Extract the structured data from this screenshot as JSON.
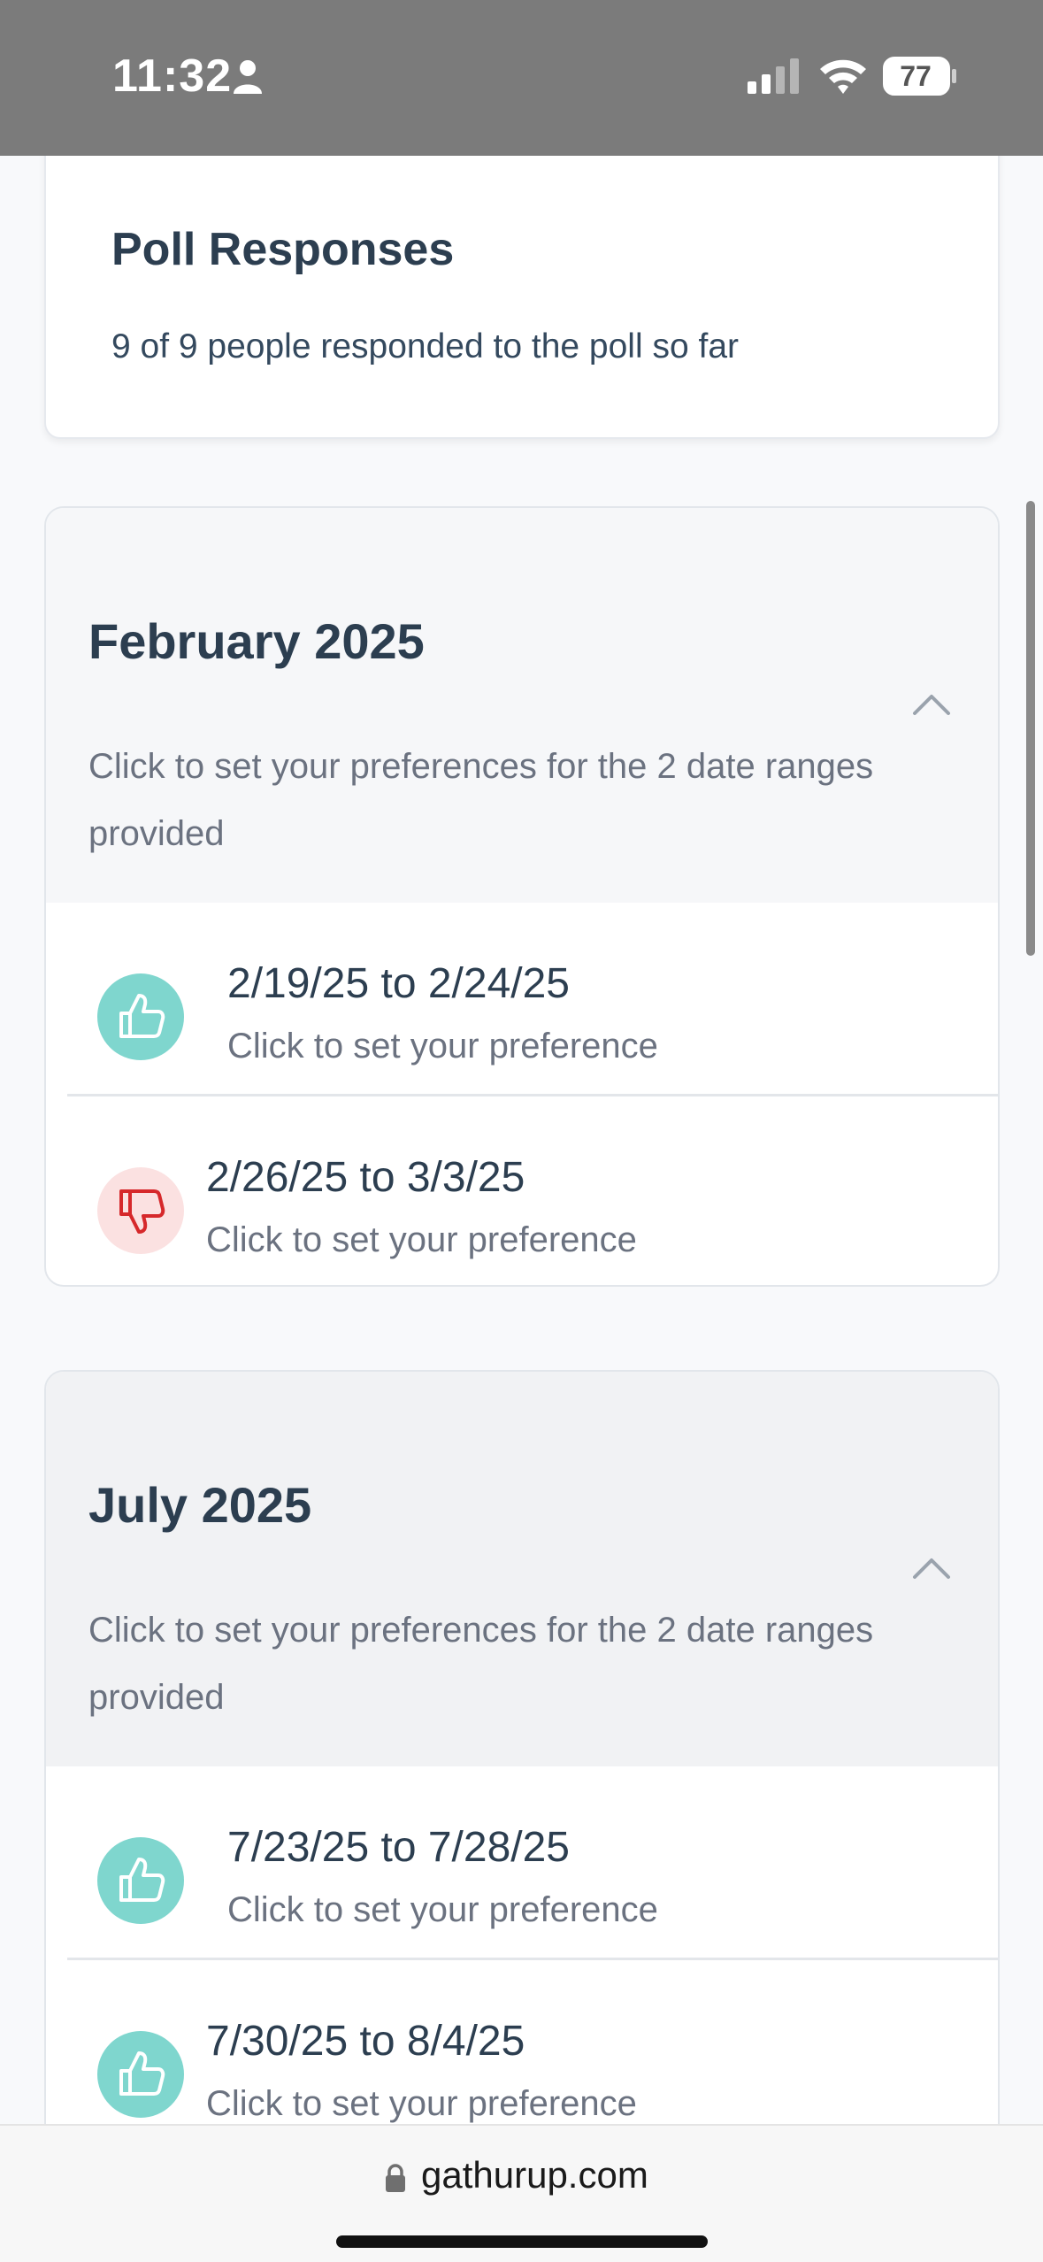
{
  "status_bar": {
    "time": "11:32",
    "battery": "77",
    "icons": [
      "person-icon",
      "signal-icon",
      "wifi-icon",
      "battery-icon"
    ]
  },
  "summary": {
    "title": "Poll Responses",
    "text": "9 of 9 people responded to the poll so far"
  },
  "months": [
    {
      "title": "February 2025",
      "description": "Click to set your preferences for the 2 date ranges provided",
      "ranges": [
        {
          "label": "2/19/25 to 2/24/25",
          "hint": "Click to set your preference",
          "vote": "thumbs-up"
        },
        {
          "label": "2/26/25 to 3/3/25",
          "hint": "Click to set your preference",
          "vote": "thumbs-down"
        }
      ]
    },
    {
      "title": "July 2025",
      "description": "Click to set your preferences for the 2 date ranges provided",
      "ranges": [
        {
          "label": "7/23/25 to 7/28/25",
          "hint": "Click to set your preference",
          "vote": "thumbs-up"
        },
        {
          "label": "7/30/25 to 8/4/25",
          "hint": "Click to set your preference",
          "vote": "thumbs-up"
        }
      ]
    }
  ],
  "browser": {
    "url": "gathurup.com"
  },
  "colors": {
    "thumbs_up_bg": "#7fd6ce",
    "thumbs_down_bg": "#fbe1e1",
    "thumbs_down_fg": "#d6282b",
    "heading": "#2c3e50",
    "muted": "#6b7280"
  }
}
